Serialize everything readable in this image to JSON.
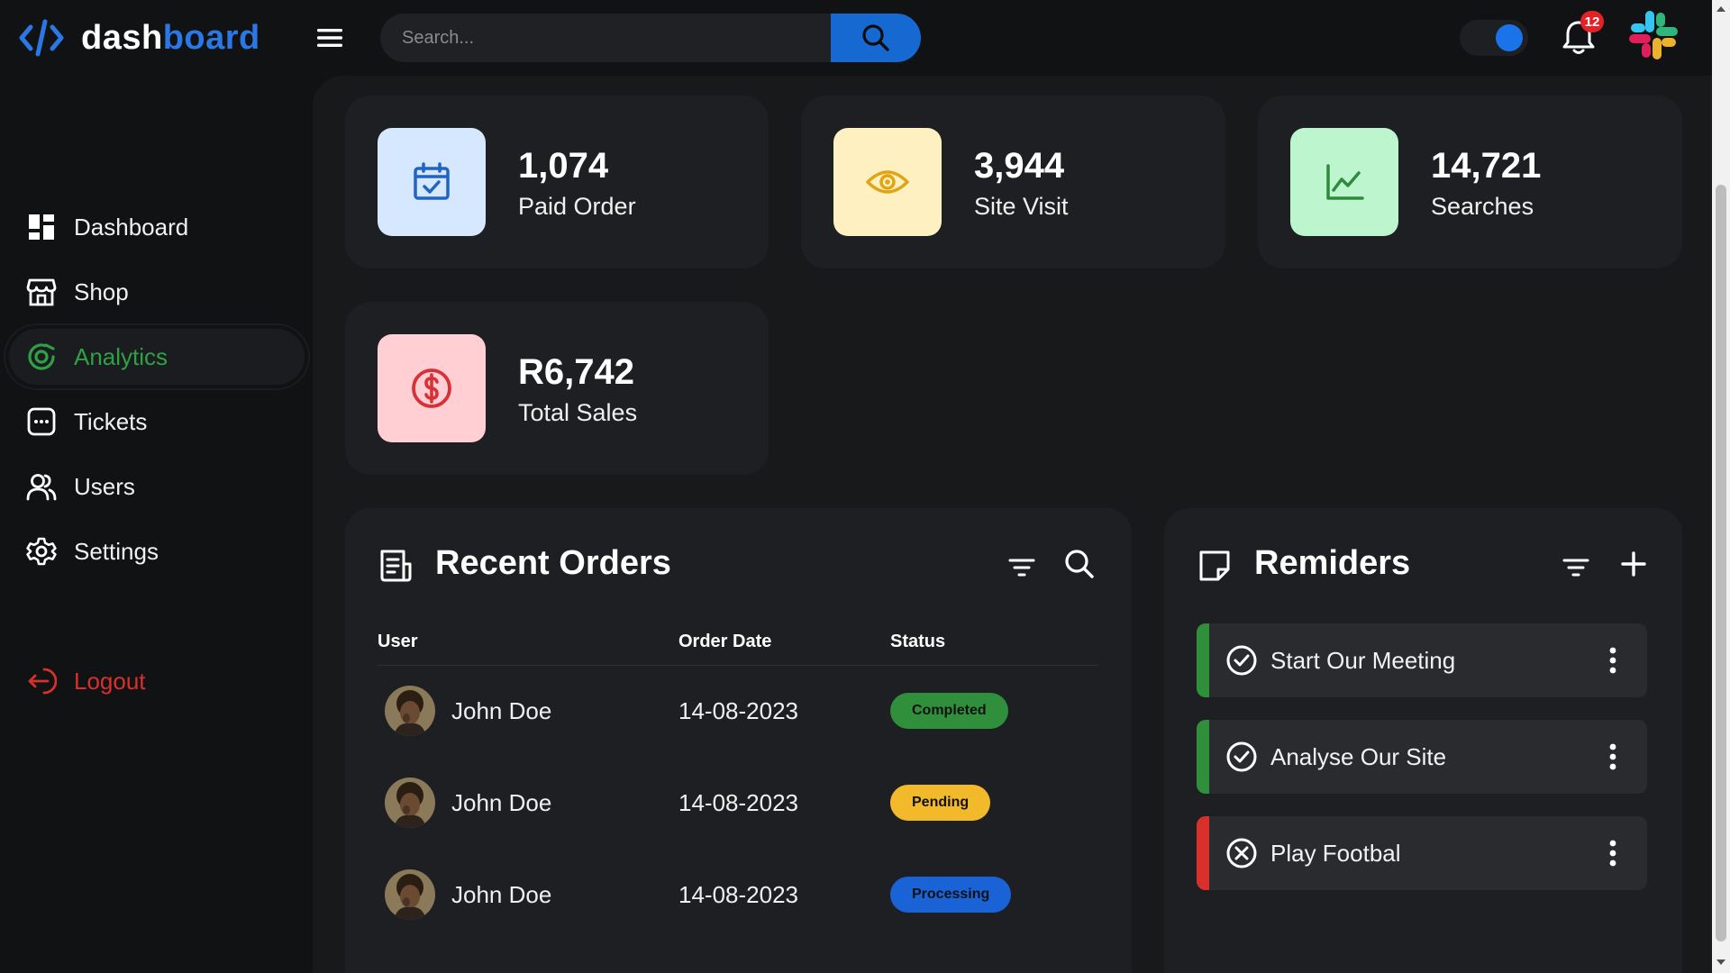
{
  "brand": {
    "part1": "dash",
    "part2": "board"
  },
  "search": {
    "placeholder": "Search..."
  },
  "notifications": {
    "count": "12"
  },
  "sidebar": {
    "items": [
      {
        "label": "Dashboard",
        "icon": "dashboard-grid-icon"
      },
      {
        "label": "Shop",
        "icon": "shop-icon"
      },
      {
        "label": "Analytics",
        "icon": "analytics-icon",
        "active": true
      },
      {
        "label": "Tickets",
        "icon": "ticket-chat-icon"
      },
      {
        "label": "Users",
        "icon": "users-icon"
      },
      {
        "label": "Settings",
        "icon": "gear-icon"
      }
    ],
    "logout": "Logout"
  },
  "stats": [
    {
      "value": "1,074",
      "label": "Paid Order",
      "icon": "calendar-check-icon",
      "tile": "#d6e8ff",
      "color": "#2064c4"
    },
    {
      "value": "3,944",
      "label": "Site Visit",
      "icon": "eye-icon",
      "tile": "#fff0c2",
      "color": "#e0a514"
    },
    {
      "value": "14,721",
      "label": "Searches",
      "icon": "line-chart-icon",
      "tile": "#bdf5cf",
      "color": "#2e8b3c"
    },
    {
      "value": "R6,742",
      "label": "Total Sales",
      "icon": "dollar-icon",
      "tile": "#ffcfd4",
      "color": "#d93036"
    }
  ],
  "orders": {
    "title": "Recent Orders",
    "columns": [
      "User",
      "Order Date",
      "Status"
    ],
    "rows": [
      {
        "user": "John Doe",
        "date": "14-08-2023",
        "status": "Completed",
        "status_class": "completed"
      },
      {
        "user": "John Doe",
        "date": "14-08-2023",
        "status": "Pending",
        "status_class": "pending"
      },
      {
        "user": "John Doe",
        "date": "14-08-2023",
        "status": "Processing",
        "status_class": "processing"
      }
    ]
  },
  "reminders": {
    "title": "Remiders",
    "items": [
      {
        "text": "Start Our Meeting",
        "state": "done",
        "color": "#2f8f3a"
      },
      {
        "text": "Analyse Our Site",
        "state": "done",
        "color": "#2f8f3a"
      },
      {
        "text": "Play Footbal",
        "state": "cancelled",
        "color": "#d9302c"
      }
    ]
  },
  "colors": {
    "accent": "#1a73e8",
    "active_nav": "#2fa043",
    "logout": "#d9302c"
  }
}
